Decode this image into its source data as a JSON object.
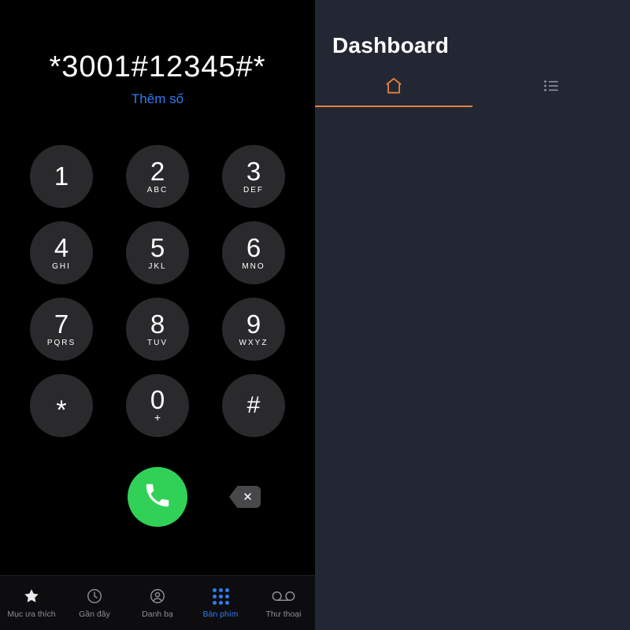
{
  "dialer": {
    "number": "*3001#12345#*",
    "add_number_label": "Thêm số",
    "keys": [
      {
        "digit": "1",
        "letters": ""
      },
      {
        "digit": "2",
        "letters": "ABC"
      },
      {
        "digit": "3",
        "letters": "DEF"
      },
      {
        "digit": "4",
        "letters": "GHI"
      },
      {
        "digit": "5",
        "letters": "JKL"
      },
      {
        "digit": "6",
        "letters": "MNO"
      },
      {
        "digit": "7",
        "letters": "PQRS"
      },
      {
        "digit": "8",
        "letters": "TUV"
      },
      {
        "digit": "9",
        "letters": "WXYZ"
      },
      {
        "digit": "*",
        "letters": ""
      },
      {
        "digit": "0",
        "letters": "+"
      },
      {
        "digit": "#",
        "letters": ""
      }
    ],
    "call_button_icon": "phone-icon",
    "backspace_icon": "backspace-icon",
    "tabs": [
      {
        "label": "Mục ưa thích",
        "icon": "star-icon",
        "active": false
      },
      {
        "label": "Gần đây",
        "icon": "clock-icon",
        "active": false
      },
      {
        "label": "Danh bạ",
        "icon": "person-icon",
        "active": false
      },
      {
        "label": "Bàn phím",
        "icon": "keypad-icon",
        "active": true
      },
      {
        "label": "Thư thoại",
        "icon": "voicemail-icon",
        "active": false
      }
    ]
  },
  "dashboard": {
    "title": "Dashboard",
    "tabs": [
      {
        "icon": "home-icon",
        "active": true
      },
      {
        "icon": "list-icon",
        "active": false
      }
    ]
  },
  "colors": {
    "accent_blue": "#2f7cf6",
    "call_green": "#31d158",
    "dashboard_bg": "#232733",
    "dashboard_accent": "#e8813a",
    "key_bg": "#2a2a2c"
  }
}
